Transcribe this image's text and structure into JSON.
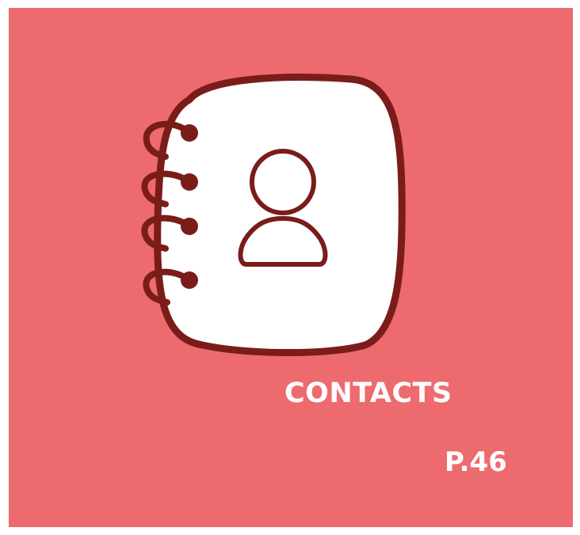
{
  "card": {
    "title": "CONTACTS",
    "page_ref": "P.46",
    "icon": "address-book-icon"
  },
  "colors": {
    "background": "#ed6a6f",
    "icon_stroke": "#7a1c1a",
    "icon_fill": "#ffffff",
    "text": "#ffffff"
  }
}
